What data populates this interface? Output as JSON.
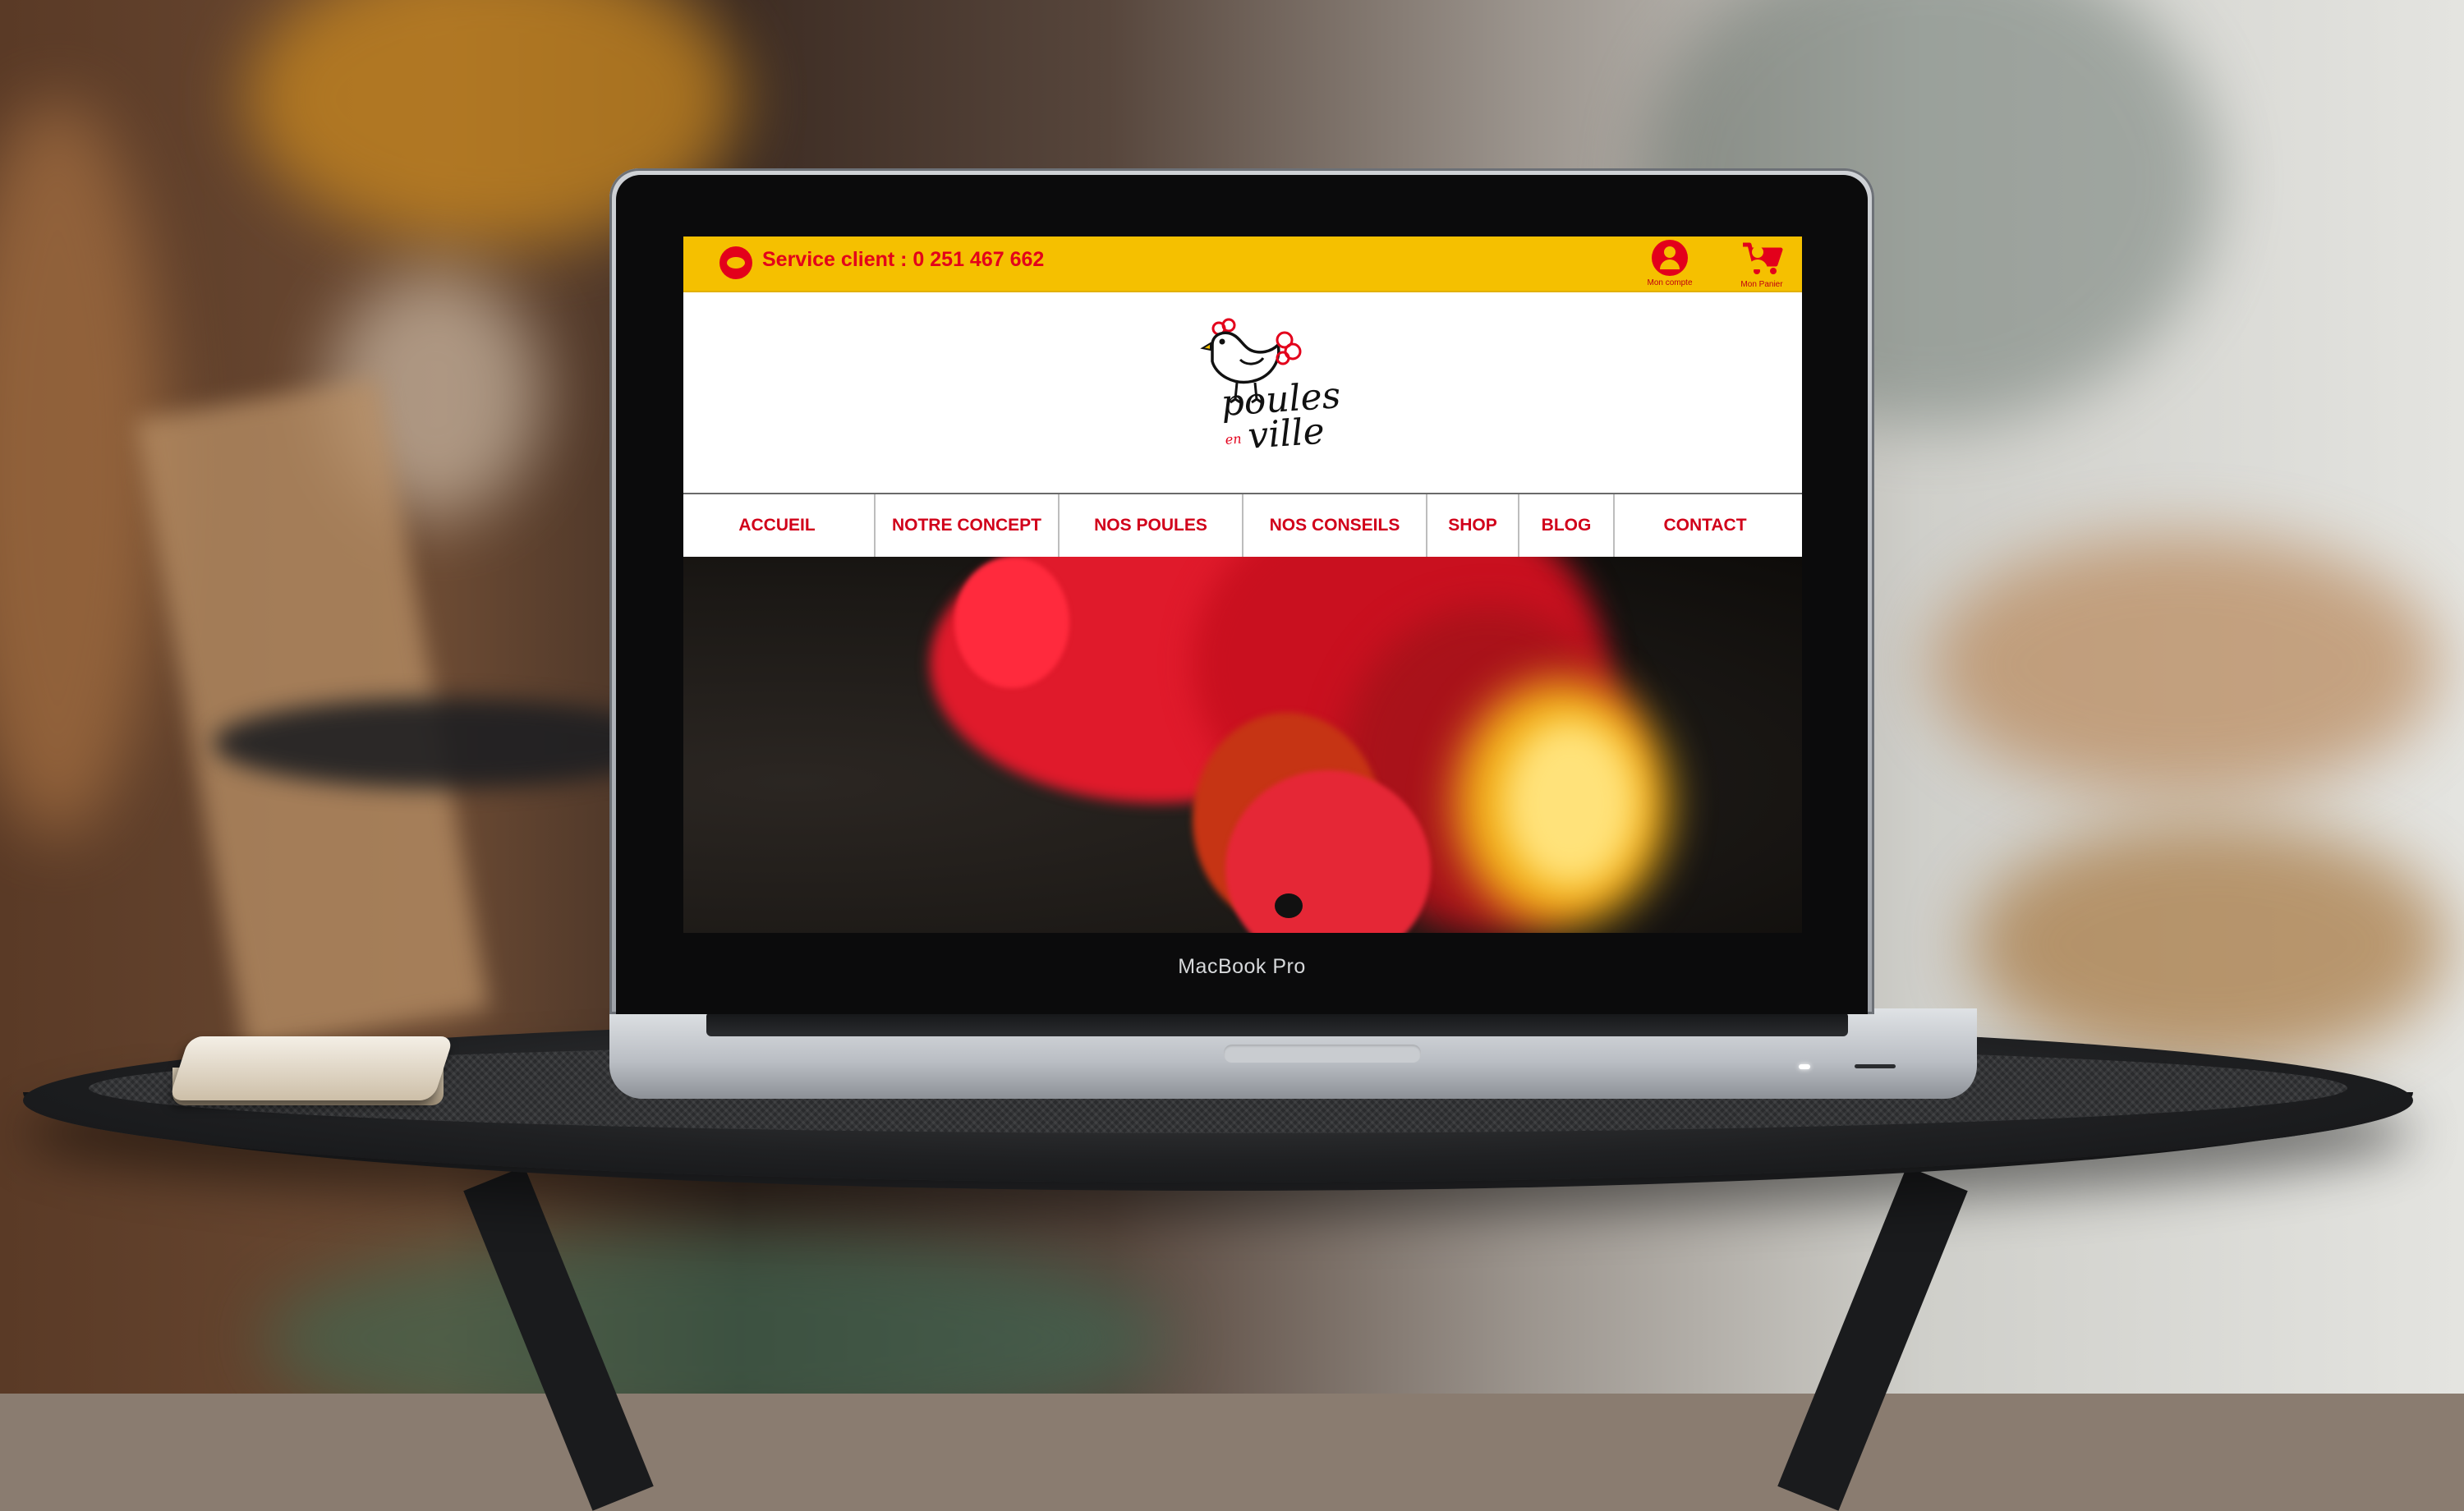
{
  "device": {
    "brand": "MacBook Pro"
  },
  "site": {
    "topbar": {
      "service_text": "Service client : 0 251 467 662",
      "account_label": "Mon compte",
      "cart_label": "Mon Panier"
    },
    "logo": {
      "line1": "poules",
      "connector": "en",
      "line2": "ville"
    },
    "nav": {
      "items": [
        {
          "label": "ACCUEIL"
        },
        {
          "label": "NOTRE CONCEPT"
        },
        {
          "label": "NOS POULES"
        },
        {
          "label": "NOS CONSEILS"
        },
        {
          "label": "SHOP"
        },
        {
          "label": "BLOG"
        },
        {
          "label": "CONTACT"
        }
      ]
    },
    "colors": {
      "brand_yellow": "#f5c000",
      "brand_red": "#e3001b"
    },
    "icons": {
      "service": "headset-icon",
      "account": "user-icon",
      "cart": "cart-icon"
    }
  }
}
